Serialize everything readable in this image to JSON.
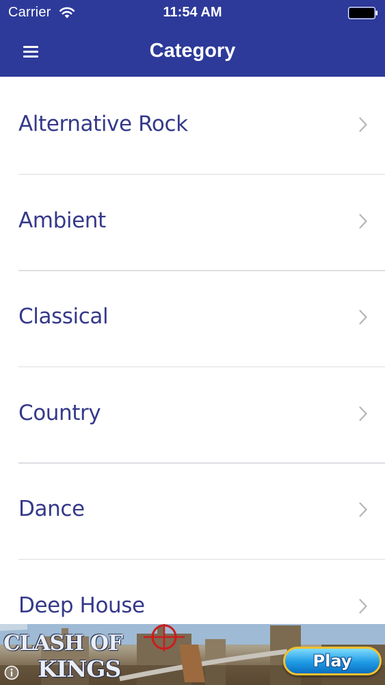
{
  "status_bar": {
    "carrier": "Carrier",
    "time": "11:54 AM",
    "icons": [
      "wifi-icon",
      "battery-icon"
    ]
  },
  "nav": {
    "title": "Category",
    "menu_icon": "hamburger-menu-icon"
  },
  "categories": [
    {
      "label": "Alternative Rock"
    },
    {
      "label": "Ambient"
    },
    {
      "label": "Classical"
    },
    {
      "label": "Country"
    },
    {
      "label": "Dance"
    },
    {
      "label": "Deep House"
    }
  ],
  "ad": {
    "logo_line1": "CLASH OF",
    "logo_line2": "KINGS",
    "play_label": "Play",
    "info_icon": "info-icon"
  },
  "colors": {
    "nav_bar": "#2d3a9a",
    "category_text": "#35398a",
    "divider": "#dddde2",
    "chevron": "#b5b5ba"
  }
}
